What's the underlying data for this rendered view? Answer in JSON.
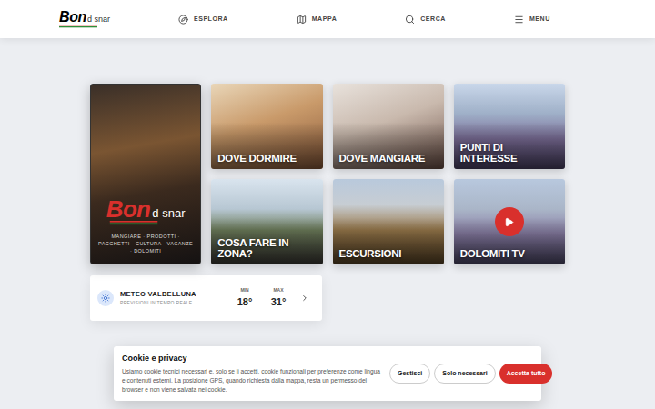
{
  "header": {
    "logo": {
      "main": "Bon",
      "sub": "d snar"
    },
    "nav": [
      {
        "label": "ESPLORA"
      },
      {
        "label": "MAPPA"
      },
      {
        "label": "CERCA"
      },
      {
        "label": "MENU"
      }
    ]
  },
  "feature": {
    "logo": {
      "main": "Bon",
      "sub": "d snar"
    },
    "tagline": "MANGIARE · PRODOTTI · PACCHETTI · CULTURA · VACANZE · DOLOMITI"
  },
  "tiles": [
    {
      "label": "DOVE DORMIRE",
      "kind": "photo"
    },
    {
      "label": "DOVE MANGIARE",
      "kind": "photo"
    },
    {
      "label": "PUNTI DI INTERESSE",
      "kind": "photo"
    },
    {
      "label": "COSA FARE IN ZONA?",
      "kind": "photo"
    },
    {
      "label": "ESCURSIONI",
      "kind": "photo"
    },
    {
      "label": "DOLOMITI TV",
      "kind": "video"
    }
  ],
  "weather": {
    "title": "METEO VALBELLUNA",
    "subtitle": "PREVISIONI IN TEMPO REALE",
    "min_label": "MIN",
    "min": "18°",
    "max_label": "MAX",
    "max": "31°"
  },
  "cookie": {
    "title": "Cookie e privacy",
    "text": "Usiamo cookie tecnici necessari e, solo se li accetti, cookie funzionali per preferenze come lingua e contenuti esterni. La posizione GPS, quando richiesta dalla mappa, resta un permesso del browser e non viene salvata nei cookie.",
    "buttons": [
      {
        "label": "Gestisci",
        "primary": false
      },
      {
        "label": "Solo necessari",
        "primary": false
      },
      {
        "label": "Accetta tutto",
        "primary": true
      }
    ]
  }
}
